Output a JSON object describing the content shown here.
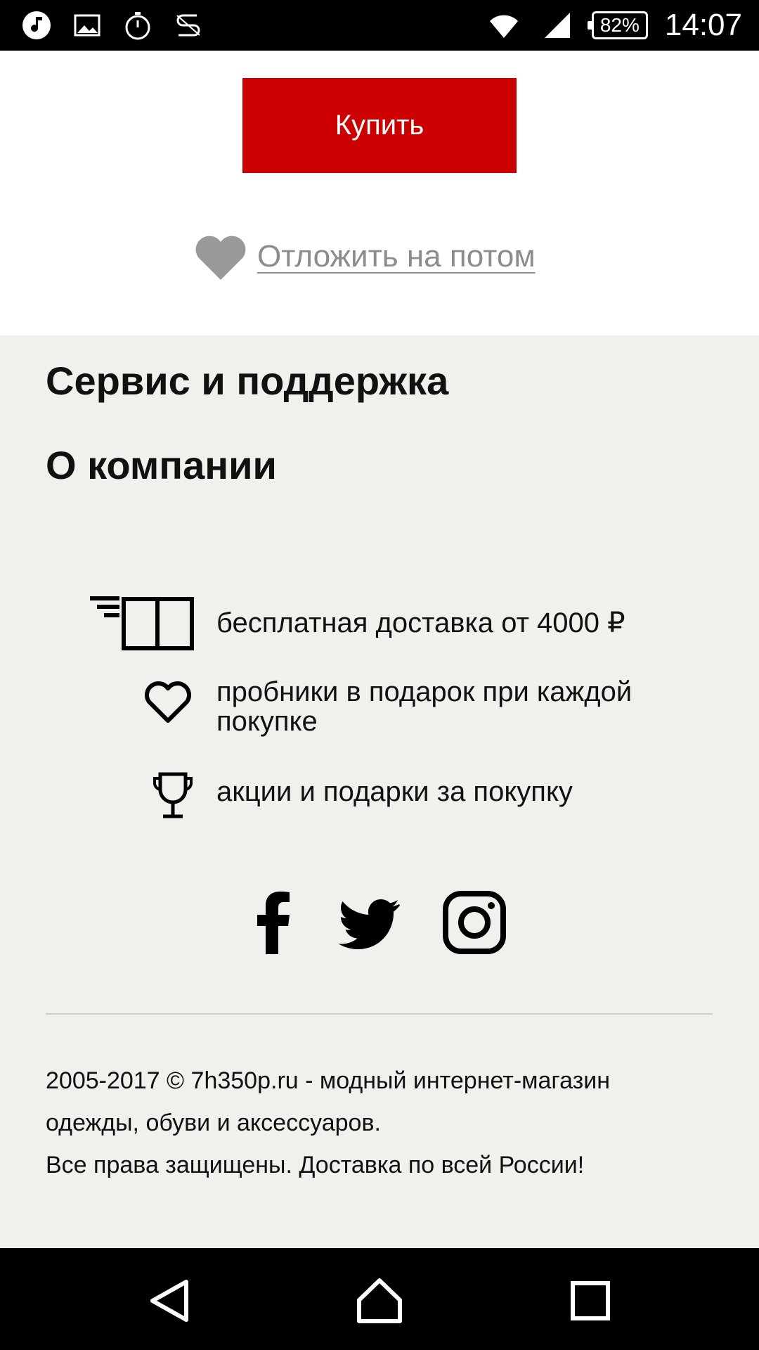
{
  "status_bar": {
    "left_icons": [
      "music-icon",
      "gallery-icon",
      "stopwatch-icon",
      "s-app-icon"
    ],
    "right_icons": [
      "wifi-icon",
      "signal-icon"
    ],
    "battery": "82%",
    "time": "14:07"
  },
  "product": {
    "buy_label": "Купить",
    "wishlist_label": "Отложить на потом",
    "accent_color": "#cc0000"
  },
  "footer": {
    "links": [
      "Сервис и поддержка",
      "О компании"
    ],
    "features": [
      {
        "icon": "delivery-icon",
        "text": "бесплатная доставка от 4000 ₽"
      },
      {
        "icon": "heart-outline-icon",
        "text": "пробники в подарок при каждой покупке"
      },
      {
        "icon": "trophy-icon",
        "text": "акции и подарки за покупку"
      }
    ],
    "socials": [
      "facebook-icon",
      "twitter-icon",
      "instagram-icon"
    ],
    "copyright_lines": [
      "2005-2017 © 7h350p.ru - модный интернет-магазин",
      "одежды, обуви и аксессуаров.",
      "Все права защищены. Доставка по всей России!"
    ],
    "background_color": "#f0f0ec"
  },
  "nav_bar": {
    "buttons": [
      "back-icon",
      "home-icon",
      "recents-icon"
    ]
  }
}
